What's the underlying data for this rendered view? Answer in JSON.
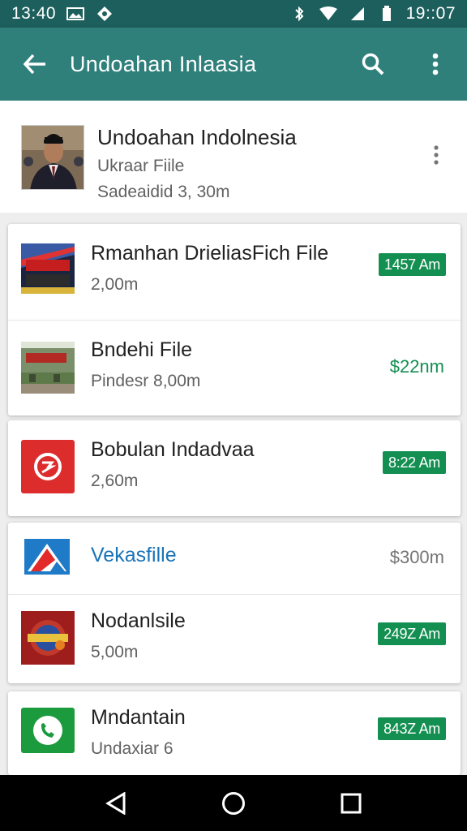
{
  "status_bar": {
    "left_time": "13:40",
    "right_time": "19::07",
    "icons": [
      "image-icon",
      "notification-icon",
      "bluetooth-icon",
      "wifi-icon",
      "signal-icon",
      "battery-icon"
    ]
  },
  "app_bar": {
    "title": "Undoahan Inlaasia",
    "icons": [
      "back-arrow-icon",
      "search-icon",
      "more-vert-icon"
    ],
    "color": "#2f7f7b"
  },
  "header": {
    "name": "Undoahan Indolnesia",
    "subtitle": "Ukraar Fiile",
    "meta": "Sadeaidid 3, 30m"
  },
  "cards": [
    {
      "rows": [
        {
          "title": "Rmanhan DrieliasFich File",
          "subtitle": "2,00m",
          "badge": "1457 Am",
          "thumb": "red-poster-thumbnail"
        },
        {
          "title": "Bndehi File",
          "subtitle": "Pindesr 8,00m",
          "price": "$22nm",
          "thumb": "building-thumbnail"
        }
      ]
    },
    {
      "rows": [
        {
          "title": "Bobulan Indadvaa",
          "subtitle": "2,60m",
          "badge": "8:22 Am",
          "thumb": "red-app-icon"
        }
      ]
    },
    {
      "rows": [
        {
          "title": "Vekasfille",
          "price": "$300m",
          "thumb": "blue-red-logo-icon"
        },
        {
          "title": "Nodanlsile",
          "subtitle": "5,00m",
          "badge": "249Z Am",
          "thumb": "red-emblem-thumbnail"
        }
      ]
    },
    {
      "rows": [
        {
          "title": "Mndantain",
          "subtitle": "Undaxiar 6",
          "badge": "843Z Am",
          "thumb": "green-phone-icon"
        }
      ]
    }
  ],
  "accent_colors": {
    "badge": "#148f52",
    "link": "#1a74b8",
    "status_bar": "#1d5f5c"
  },
  "nav_bar": {
    "icons": [
      "back-triangle-icon",
      "home-circle-icon",
      "recents-square-icon"
    ]
  }
}
